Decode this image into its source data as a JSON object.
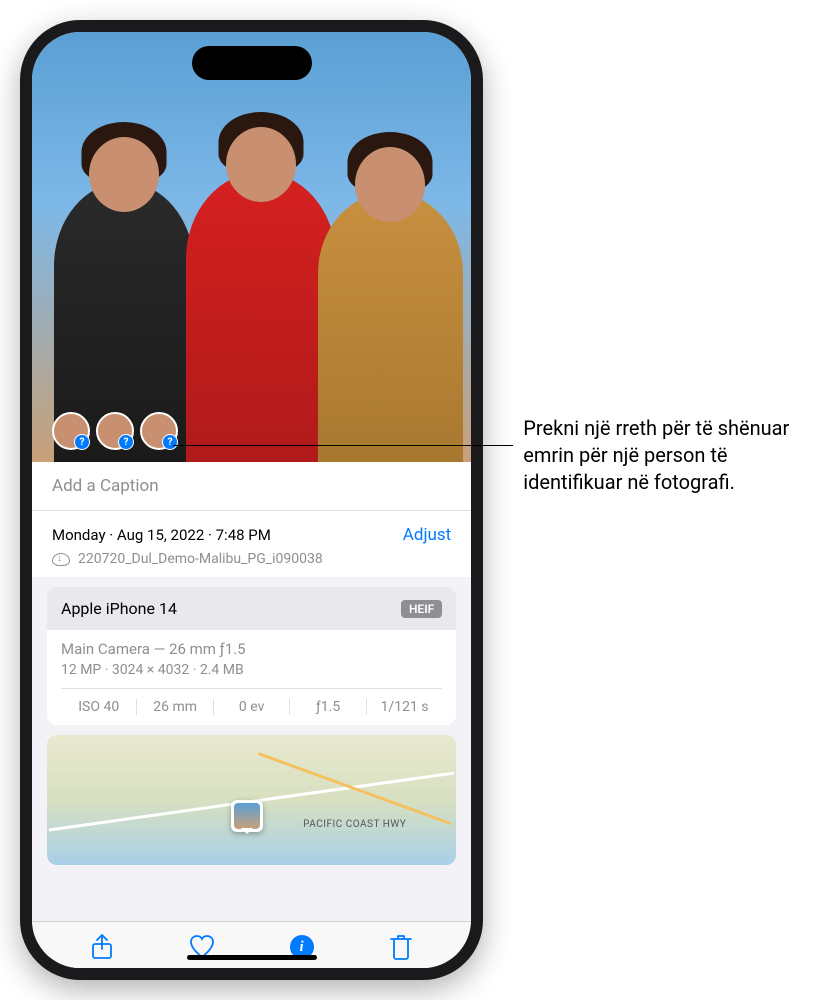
{
  "caption": {
    "placeholder": "Add a Caption"
  },
  "datetime": {
    "day": "Monday",
    "date": "Aug 15, 2022",
    "time": "7:48 PM",
    "full": "Monday · Aug 15, 2022 · 7:48 PM",
    "adjust_label": "Adjust"
  },
  "file": {
    "name": "220720_Dul_Demo-Malibu_PG_i090038"
  },
  "camera": {
    "device": "Apple iPhone 14",
    "format_badge": "HEIF",
    "lens": "Main Camera — 26 mm ƒ1.5",
    "megapixels": "12 MP",
    "resolution": "3024 × 4032",
    "filesize": "2.4 MB",
    "specs_line": "12 MP · 3024 × 4032 · 2.4 MB",
    "exif": {
      "iso": "ISO 40",
      "focal": "26 mm",
      "ev": "0 ev",
      "aperture": "ƒ1.5",
      "shutter": "1/121 s"
    }
  },
  "map": {
    "road_label": "PACIFIC COAST HWY"
  },
  "callout": {
    "text": "Prekni një rreth për të shënuar emrin për një person të identifikuar në fotografi."
  },
  "face_badges": [
    "?",
    "?",
    "?"
  ]
}
